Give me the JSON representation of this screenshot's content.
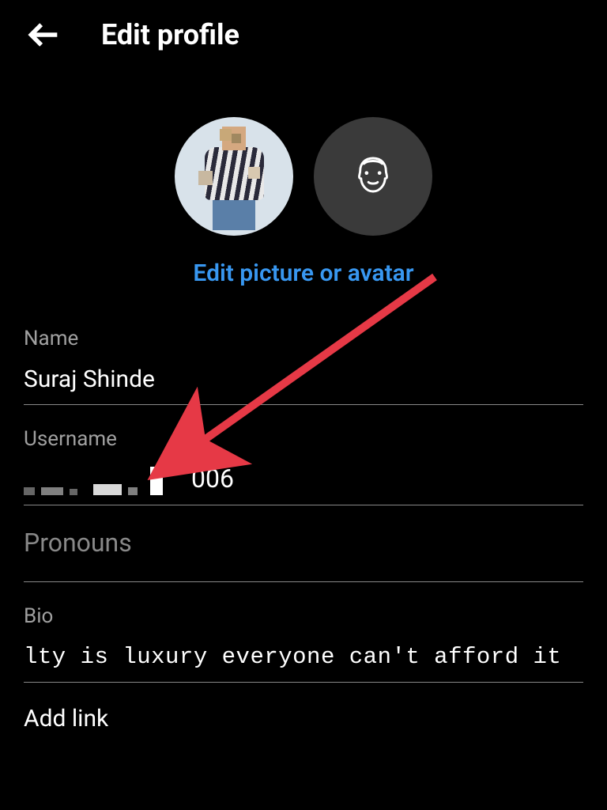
{
  "header": {
    "title": "Edit profile"
  },
  "avatar": {
    "edit_link": "Edit picture or avatar"
  },
  "fields": {
    "name": {
      "label": "Name",
      "value": "Suraj Shinde"
    },
    "username": {
      "label": "Username",
      "partial_visible": "006"
    },
    "pronouns": {
      "label": "Pronouns",
      "value": ""
    },
    "bio": {
      "label": "Bio",
      "value": "lty is luxury everyone can't afford it"
    },
    "add_link": {
      "label": "Add link"
    }
  },
  "colors": {
    "link_blue": "#3897f0",
    "arrow_red": "#e63946"
  }
}
